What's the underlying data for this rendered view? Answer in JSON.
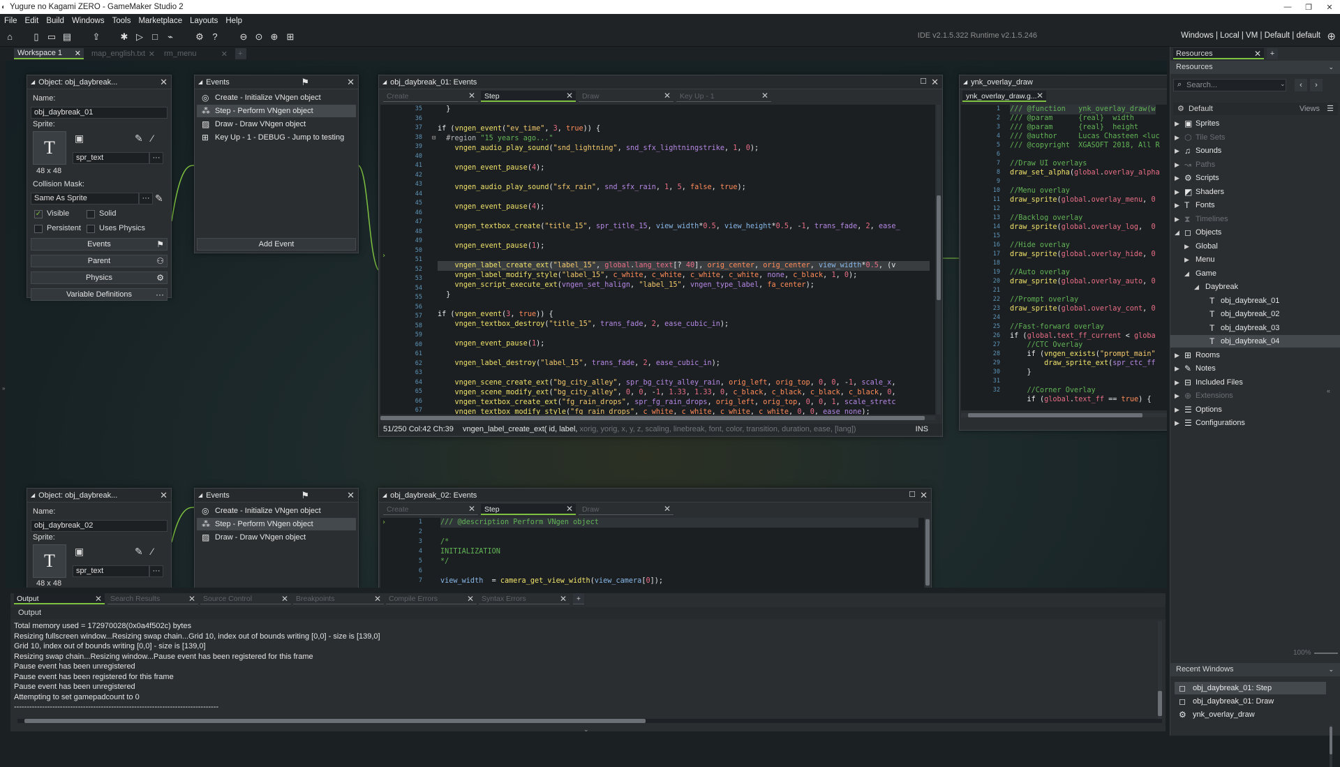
{
  "window": {
    "title": "Yugure no Kagami ZERO - GameMaker Studio 2",
    "controls": [
      "—",
      "❐",
      "✕"
    ]
  },
  "menu": [
    "File",
    "Edit",
    "Build",
    "Windows",
    "Tools",
    "Marketplace",
    "Layouts",
    "Help"
  ],
  "toolbar": {
    "ide_version": "IDE v2.1.5.322 Runtime v2.1.5.246",
    "target": "Windows | Local | VM | Default | default",
    "icons": [
      "home-icon",
      "new-project-icon",
      "open-project-icon",
      "save-icon",
      "export-icon",
      "debug-icon",
      "run-icon",
      "stop-icon",
      "clean-icon",
      "game-options-icon",
      "help-icon",
      "zoom-out-icon",
      "zoom-reset-icon",
      "zoom-in-icon",
      "fit-icon",
      "target-icon"
    ]
  },
  "workspace_tabs": [
    "Workspace 1",
    "map_english.txt",
    "rm_menu",
    "+"
  ],
  "object1": {
    "header": "Object: obj_daybreak...",
    "name_label": "Name:",
    "name": "obj_daybreak_01",
    "sprite_label": "Sprite:",
    "sprite": "spr_text",
    "size": "48 x 48",
    "mask_label": "Collision Mask:",
    "mask": "Same As Sprite",
    "visible": "Visible",
    "solid": "Solid",
    "persistent": "Persistent",
    "uses_physics": "Uses Physics",
    "events_btn": "Events",
    "parent_btn": "Parent",
    "physics_btn": "Physics",
    "vardef_btn": "Variable Definitions",
    "ellipsis": "···",
    "sprite_glyph": "T"
  },
  "events1": {
    "header": "Events",
    "items": [
      "Create - Initialize VNgen object",
      "Step - Perform VNgen object",
      "Draw - Draw VNgen object",
      "Key Up - 1 - DEBUG - Jump to testing"
    ],
    "add_event": "Add Event"
  },
  "editor1": {
    "header": "obj_daybreak_01: Events",
    "tabs": [
      "Create",
      "Step",
      "Draw",
      "Key Up - 1"
    ],
    "line_numbers": [
      "35",
      "36",
      "37",
      "38",
      "39",
      "40",
      "41",
      "42",
      "43",
      "44",
      "45",
      "46",
      "47",
      "48",
      "49",
      "50",
      "51",
      "52",
      "53",
      "54",
      "55",
      "56",
      "57",
      "58",
      "59",
      "60",
      "61",
      "62",
      "63",
      "64",
      "65",
      "66",
      "67"
    ],
    "status": "51/250 Col:42 Ch:39",
    "signature": "vngen_label_create_ext( id, label,",
    "signature_hint": " xorig, yorig, x, y, z, scaling, linebreak, font, color, transition, duration, ease, [lang])",
    "mode": "INS"
  },
  "overlay_editor": {
    "header": "ynk_overlay_draw",
    "tab": "ynk_overlay_draw.g...",
    "line_numbers": [
      "1",
      "2",
      "3",
      "4",
      "5",
      "6",
      "7",
      "8",
      "9",
      "10",
      "11",
      "12",
      "13",
      "14",
      "15",
      "16",
      "17",
      "18",
      "19",
      "20",
      "21",
      "22",
      "23",
      "24",
      "25",
      "26",
      "27",
      "28",
      "29",
      "30",
      "31",
      "32"
    ]
  },
  "object2": {
    "header": "Object: obj_daybreak...",
    "name_label": "Name:",
    "name": "obj_daybreak_02",
    "sprite_label": "Sprite:",
    "sprite": "spr_text",
    "size": "48 x 48",
    "ellipsis": "···",
    "sprite_glyph": "T"
  },
  "events2": {
    "header": "Events",
    "items": [
      "Create - Initialize VNgen object",
      "Step - Perform VNgen object",
      "Draw - Draw VNgen object"
    ]
  },
  "editor2": {
    "header": "obj_daybreak_02: Events",
    "tabs": [
      "Create",
      "Step",
      "Draw"
    ],
    "line_numbers": [
      "1",
      "2",
      "3",
      "4",
      "5",
      "6",
      "7"
    ]
  },
  "resources": {
    "tab": "Resources",
    "title": "Resources",
    "search_placeholder": "Search...",
    "default_label": "Default",
    "views_label": "Views",
    "tree": [
      {
        "label": "Sprites",
        "dim": false,
        "level": 0,
        "arrow": "▶",
        "icon": "▣"
      },
      {
        "label": "Tile Sets",
        "dim": true,
        "level": 0,
        "arrow": "▶",
        "icon": "⬡"
      },
      {
        "label": "Sounds",
        "dim": false,
        "level": 0,
        "arrow": "▶",
        "icon": "♫"
      },
      {
        "label": "Paths",
        "dim": true,
        "level": 0,
        "arrow": "▶",
        "icon": "↝"
      },
      {
        "label": "Scripts",
        "dim": false,
        "level": 0,
        "arrow": "▶",
        "icon": "⚙"
      },
      {
        "label": "Shaders",
        "dim": false,
        "level": 0,
        "arrow": "▶",
        "icon": "◩"
      },
      {
        "label": "Fonts",
        "dim": false,
        "level": 0,
        "arrow": "▶",
        "icon": "T"
      },
      {
        "label": "Timelines",
        "dim": true,
        "level": 0,
        "arrow": "▶",
        "icon": "⧗"
      },
      {
        "label": "Objects",
        "dim": false,
        "level": 0,
        "arrow": "◢",
        "icon": "◻"
      },
      {
        "label": "Global",
        "dim": false,
        "level": 1,
        "arrow": "▶",
        "icon": ""
      },
      {
        "label": "Menu",
        "dim": false,
        "level": 1,
        "arrow": "▶",
        "icon": ""
      },
      {
        "label": "Game",
        "dim": false,
        "level": 1,
        "arrow": "◢",
        "icon": ""
      },
      {
        "label": "Daybreak",
        "dim": false,
        "level": 2,
        "arrow": "◢",
        "icon": ""
      },
      {
        "label": "obj_daybreak_01",
        "dim": false,
        "level": 3,
        "arrow": "",
        "icon": "T"
      },
      {
        "label": "obj_daybreak_02",
        "dim": false,
        "level": 3,
        "arrow": "",
        "icon": "T"
      },
      {
        "label": "obj_daybreak_03",
        "dim": false,
        "level": 3,
        "arrow": "",
        "icon": "T"
      },
      {
        "label": "obj_daybreak_04",
        "dim": false,
        "level": 3,
        "arrow": "",
        "icon": "T",
        "selected": true
      },
      {
        "label": "Rooms",
        "dim": false,
        "level": 0,
        "arrow": "▶",
        "icon": "⊞"
      },
      {
        "label": "Notes",
        "dim": false,
        "level": 0,
        "arrow": "▶",
        "icon": "✎"
      },
      {
        "label": "Included Files",
        "dim": false,
        "level": 0,
        "arrow": "▶",
        "icon": "⊟"
      },
      {
        "label": "Extensions",
        "dim": true,
        "level": 0,
        "arrow": "▶",
        "icon": "⊕"
      },
      {
        "label": "Options",
        "dim": false,
        "level": 0,
        "arrow": "▶",
        "icon": "☰"
      },
      {
        "label": "Configurations",
        "dim": false,
        "level": 0,
        "arrow": "▶",
        "icon": "☰"
      }
    ],
    "zoom": "100%",
    "recent_title": "Recent Windows",
    "recent": [
      "obj_daybreak_01: Step",
      "obj_daybreak_01: Draw",
      "ynk_overlay_draw"
    ]
  },
  "output": {
    "tabs": [
      "Output",
      "Search Results",
      "Source Control",
      "Breakpoints",
      "Compile Errors",
      "Syntax Errors",
      "+"
    ],
    "title": "Output",
    "lines": [
      "Total memory used = 172970028(0x0a4f502c) bytes",
      "Resizing fullscreen window...Resizing swap chain...Grid 10, index out of bounds writing [0,0] - size is [139,0]",
      "Grid 10, index out of bounds writing [0,0] - size is [139,0]",
      "Resizing swap chain...Resizing window...Pause event has been registered for this frame",
      "Pause event has been unregistered",
      "Pause event has been registered for this frame",
      "Pause event has been unregistered",
      "Attempting to set gamepadcount to 0",
      "--------------------------------------------------------------------------------"
    ]
  },
  "colors": {
    "accent": "#7fc241",
    "background": "#1b2023",
    "panel": "#2a2e31",
    "selection": "#44494e"
  }
}
